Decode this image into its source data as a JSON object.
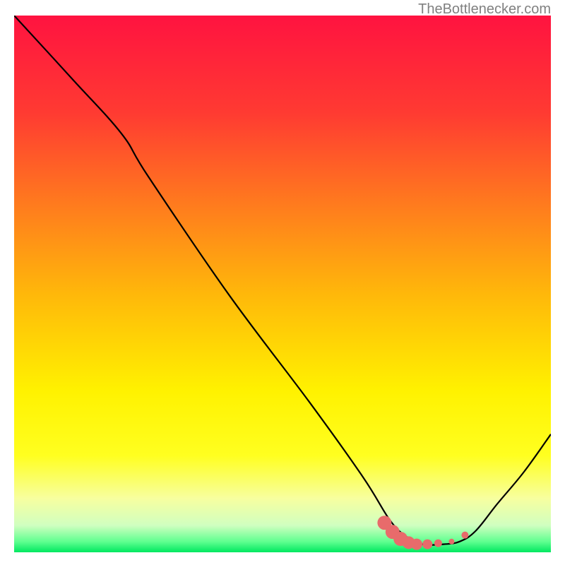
{
  "watermark": "TheBottlenecker.com",
  "chart_data": {
    "type": "line",
    "title": "",
    "xlabel": "",
    "ylabel": "",
    "xlim": [
      0,
      100
    ],
    "ylim": [
      0,
      100
    ],
    "series": [
      {
        "name": "curve",
        "color": "#000000",
        "points": [
          {
            "x": 0,
            "y": 100
          },
          {
            "x": 11,
            "y": 88
          },
          {
            "x": 20,
            "y": 78
          },
          {
            "x": 25,
            "y": 70
          },
          {
            "x": 40,
            "y": 48
          },
          {
            "x": 55,
            "y": 28
          },
          {
            "x": 65,
            "y": 14
          },
          {
            "x": 70,
            "y": 6
          },
          {
            "x": 73,
            "y": 3
          },
          {
            "x": 76,
            "y": 1.5
          },
          {
            "x": 80,
            "y": 1.5
          },
          {
            "x": 83,
            "y": 2
          },
          {
            "x": 86,
            "y": 4
          },
          {
            "x": 90,
            "y": 9
          },
          {
            "x": 95,
            "y": 15
          },
          {
            "x": 100,
            "y": 22
          }
        ]
      }
    ],
    "markers": [
      {
        "x": 69,
        "y": 5.5,
        "size": 10
      },
      {
        "x": 70.5,
        "y": 3.8,
        "size": 10
      },
      {
        "x": 72,
        "y": 2.5,
        "size": 10
      },
      {
        "x": 73.5,
        "y": 1.8,
        "size": 9
      },
      {
        "x": 75,
        "y": 1.5,
        "size": 8
      },
      {
        "x": 77,
        "y": 1.5,
        "size": 7
      },
      {
        "x": 79,
        "y": 1.7,
        "size": 5.5
      },
      {
        "x": 81.5,
        "y": 2,
        "size": 4
      },
      {
        "x": 84,
        "y": 3.2,
        "size": 5
      }
    ],
    "marker_color": "#e86b6b",
    "gradient_stops": [
      {
        "offset": 0,
        "color": "#ff1340"
      },
      {
        "offset": 18,
        "color": "#ff3a32"
      },
      {
        "offset": 35,
        "color": "#ff7a1e"
      },
      {
        "offset": 52,
        "color": "#ffb80a"
      },
      {
        "offset": 70,
        "color": "#fff200"
      },
      {
        "offset": 82,
        "color": "#ffff20"
      },
      {
        "offset": 90,
        "color": "#f7ffa0"
      },
      {
        "offset": 95,
        "color": "#d0ffc0"
      },
      {
        "offset": 98,
        "color": "#60ff90"
      },
      {
        "offset": 100,
        "color": "#00e860"
      }
    ]
  }
}
